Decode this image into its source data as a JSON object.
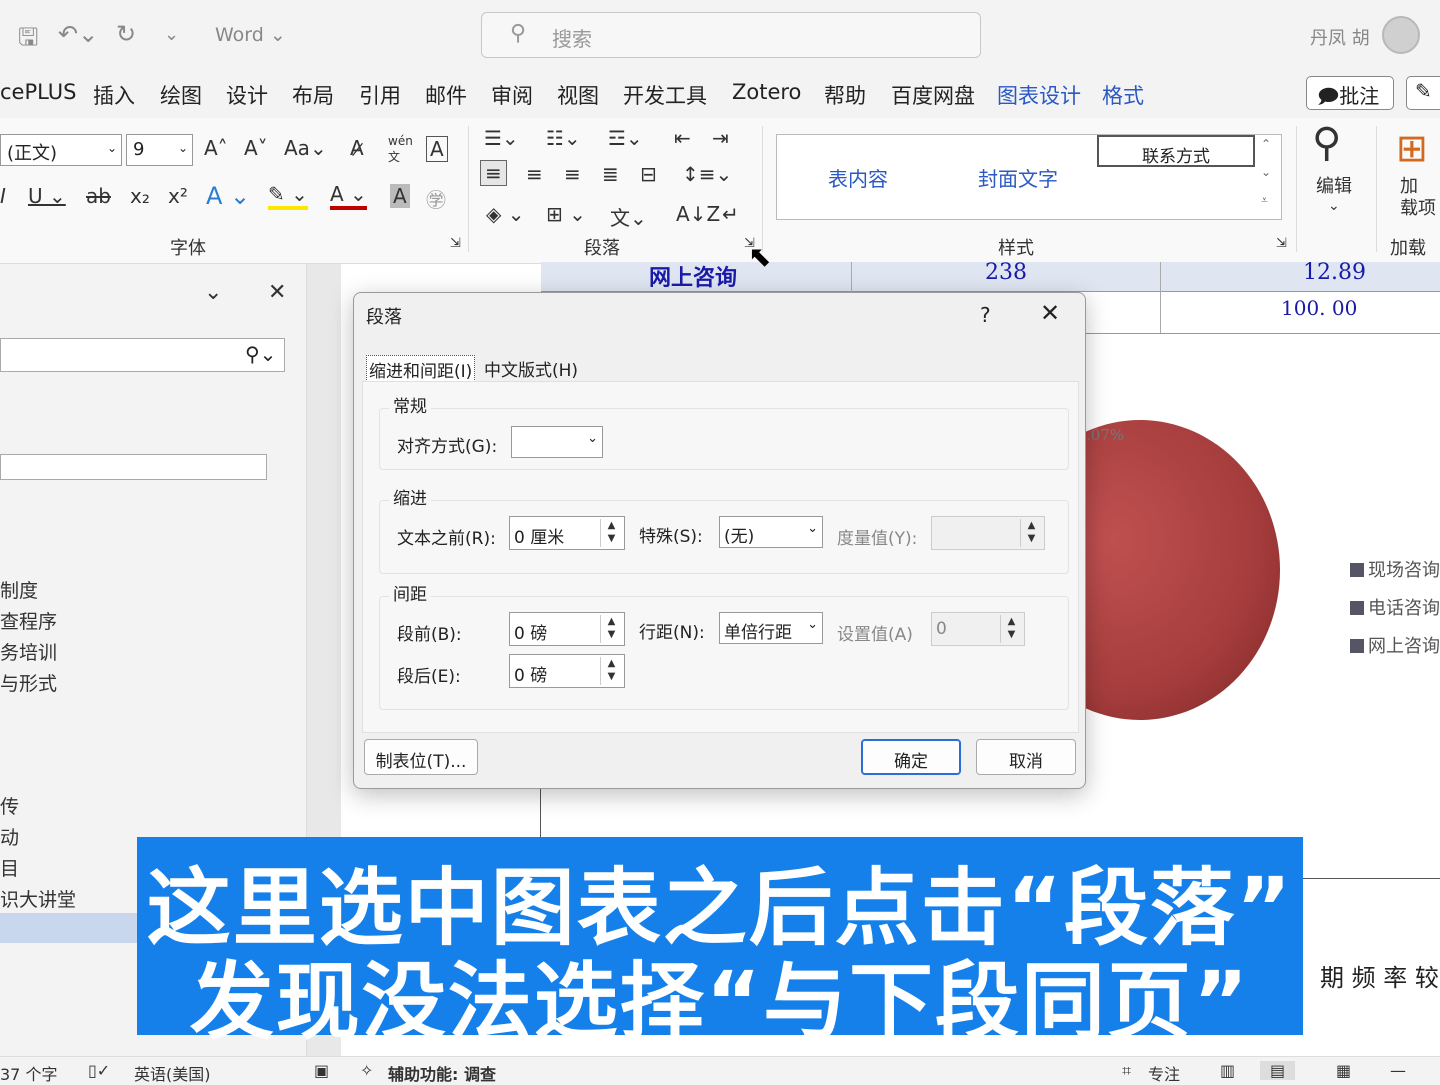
{
  "titlebar": {
    "app": "Word ⌄",
    "search_placeholder": "搜索",
    "user": "丹凤 胡"
  },
  "menu": {
    "items": [
      "cePLUS",
      "插入",
      "绘图",
      "设计",
      "布局",
      "引用",
      "邮件",
      "审阅",
      "视图",
      "开发工具",
      "Zotero",
      "帮助",
      "百度网盘",
      "图表设计",
      "格式"
    ],
    "comment": "批注"
  },
  "ribbon": {
    "font_name": "(正文)",
    "font_size": "9",
    "font_group": "字体",
    "para_group": "段落",
    "style_group": "样式",
    "addin_group": "加载项",
    "styles": [
      "表内容",
      "封面文字",
      "联系方式"
    ],
    "edit": "编辑",
    "addin_btn": "加\n载项"
  },
  "nav": {
    "items": [
      "制度",
      "查程序",
      "务培训",
      "与形式",
      "传",
      "动",
      "目",
      "识大讲堂"
    ]
  },
  "doc": {
    "row1": [
      "网上咨询",
      "238",
      "12.89"
    ],
    "row2_total": "100. 00",
    "pct": ".07%",
    "legend": [
      "现场咨询",
      "电话咨询",
      "网上咨询"
    ],
    "trail_text": "期 频 率 较"
  },
  "dialog": {
    "title": "段落",
    "help": "?",
    "close": "✕",
    "tabs": [
      "缩进和间距(I)",
      "中文版式(H)"
    ],
    "general": "常规",
    "align_label": "对齐方式(G):",
    "align_value": "",
    "indent": "缩进",
    "before_text_label": "文本之前(R):",
    "before_text_value": "0 厘米",
    "special_label": "特殊(S):",
    "special_value": "(无)",
    "measure_label": "度量值(Y):",
    "spacing": "间距",
    "before_label": "段前(B):",
    "before_value": "0 磅",
    "line_label": "行距(N):",
    "line_value": "单倍行距",
    "setting_label": "设置值(A)",
    "setting_value": "0",
    "after_label": "段后(E):",
    "after_value": "0 磅",
    "tabs_btn": "制表位(T)...",
    "ok": "确定",
    "cancel": "取消"
  },
  "caption": {
    "line1": "这里选中图表之后点击“段落”",
    "line2": "发现没法选择“与下段同页”"
  },
  "status": {
    "words": "37 个字",
    "lang": "英语(美国)",
    "access": "辅助功能: 调查",
    "focus": "专注"
  }
}
